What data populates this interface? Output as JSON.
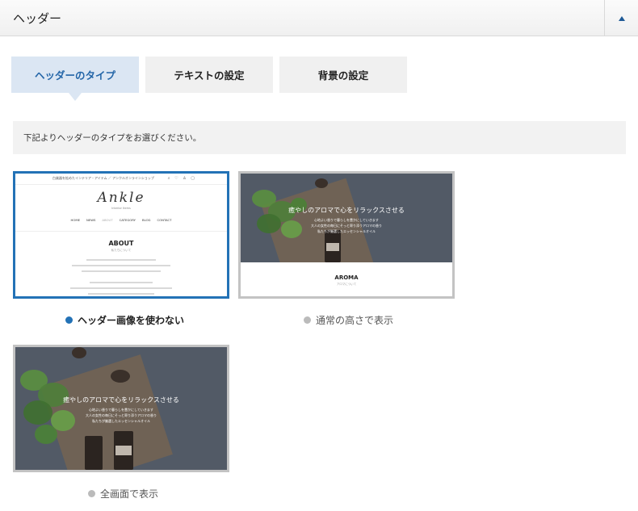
{
  "panel": {
    "title": "ヘッダー"
  },
  "tabs": [
    {
      "label": "ヘッダーのタイプ",
      "active": true
    },
    {
      "label": "テキストの設定",
      "active": false
    },
    {
      "label": "背景の設定",
      "active": false
    }
  ],
  "instructions": "下記よりヘッダーのタイプをお選びください。",
  "options": [
    {
      "label": "ヘッダー画像を使わない",
      "selected": true
    },
    {
      "label": "通常の高さで表示",
      "selected": false
    },
    {
      "label": "全画面で表示",
      "selected": false
    }
  ],
  "preview_plain": {
    "tagline": "白楽器を拡めたインテリア・アイテム ／ アンクルオンラインショップ",
    "icons": "⌕ ♡ ♙ ▢",
    "logo": "Ankle",
    "logo_sub": "Interior Items",
    "nav": [
      "HOME",
      "NEWS",
      "ABOUT",
      "CATEGORY",
      "BLOG",
      "CONTACT"
    ],
    "about_title": "ABOUT",
    "about_sub": "私たちについて"
  },
  "preview_normal": {
    "headline": "癒やしのアロマで心をリラックスさせる",
    "lines": [
      "心地よい香りで暮らしを豊かにしていきます",
      "大人の女性の毎日にそっと寄り添うアロマの香り",
      "私たちが厳選したエッセンシャルオイル"
    ],
    "footer_title": "AROMA",
    "footer_sub": "アロマについて"
  },
  "preview_full": {
    "headline": "癒やしのアロマで心をリラックスさせる",
    "lines": [
      "心地よい香りで暮らしを豊かにしていきます",
      "大人の女性の毎日にそっと寄り添うアロマの香り",
      "私たちが厳選したエッセンシャルオイル"
    ]
  },
  "colors": {
    "accent": "#2372b6",
    "tab_active_bg": "#dbe6f3",
    "tab_bg": "#f0f0f0"
  },
  "icons": {
    "collapse": "triangle-up-icon"
  }
}
